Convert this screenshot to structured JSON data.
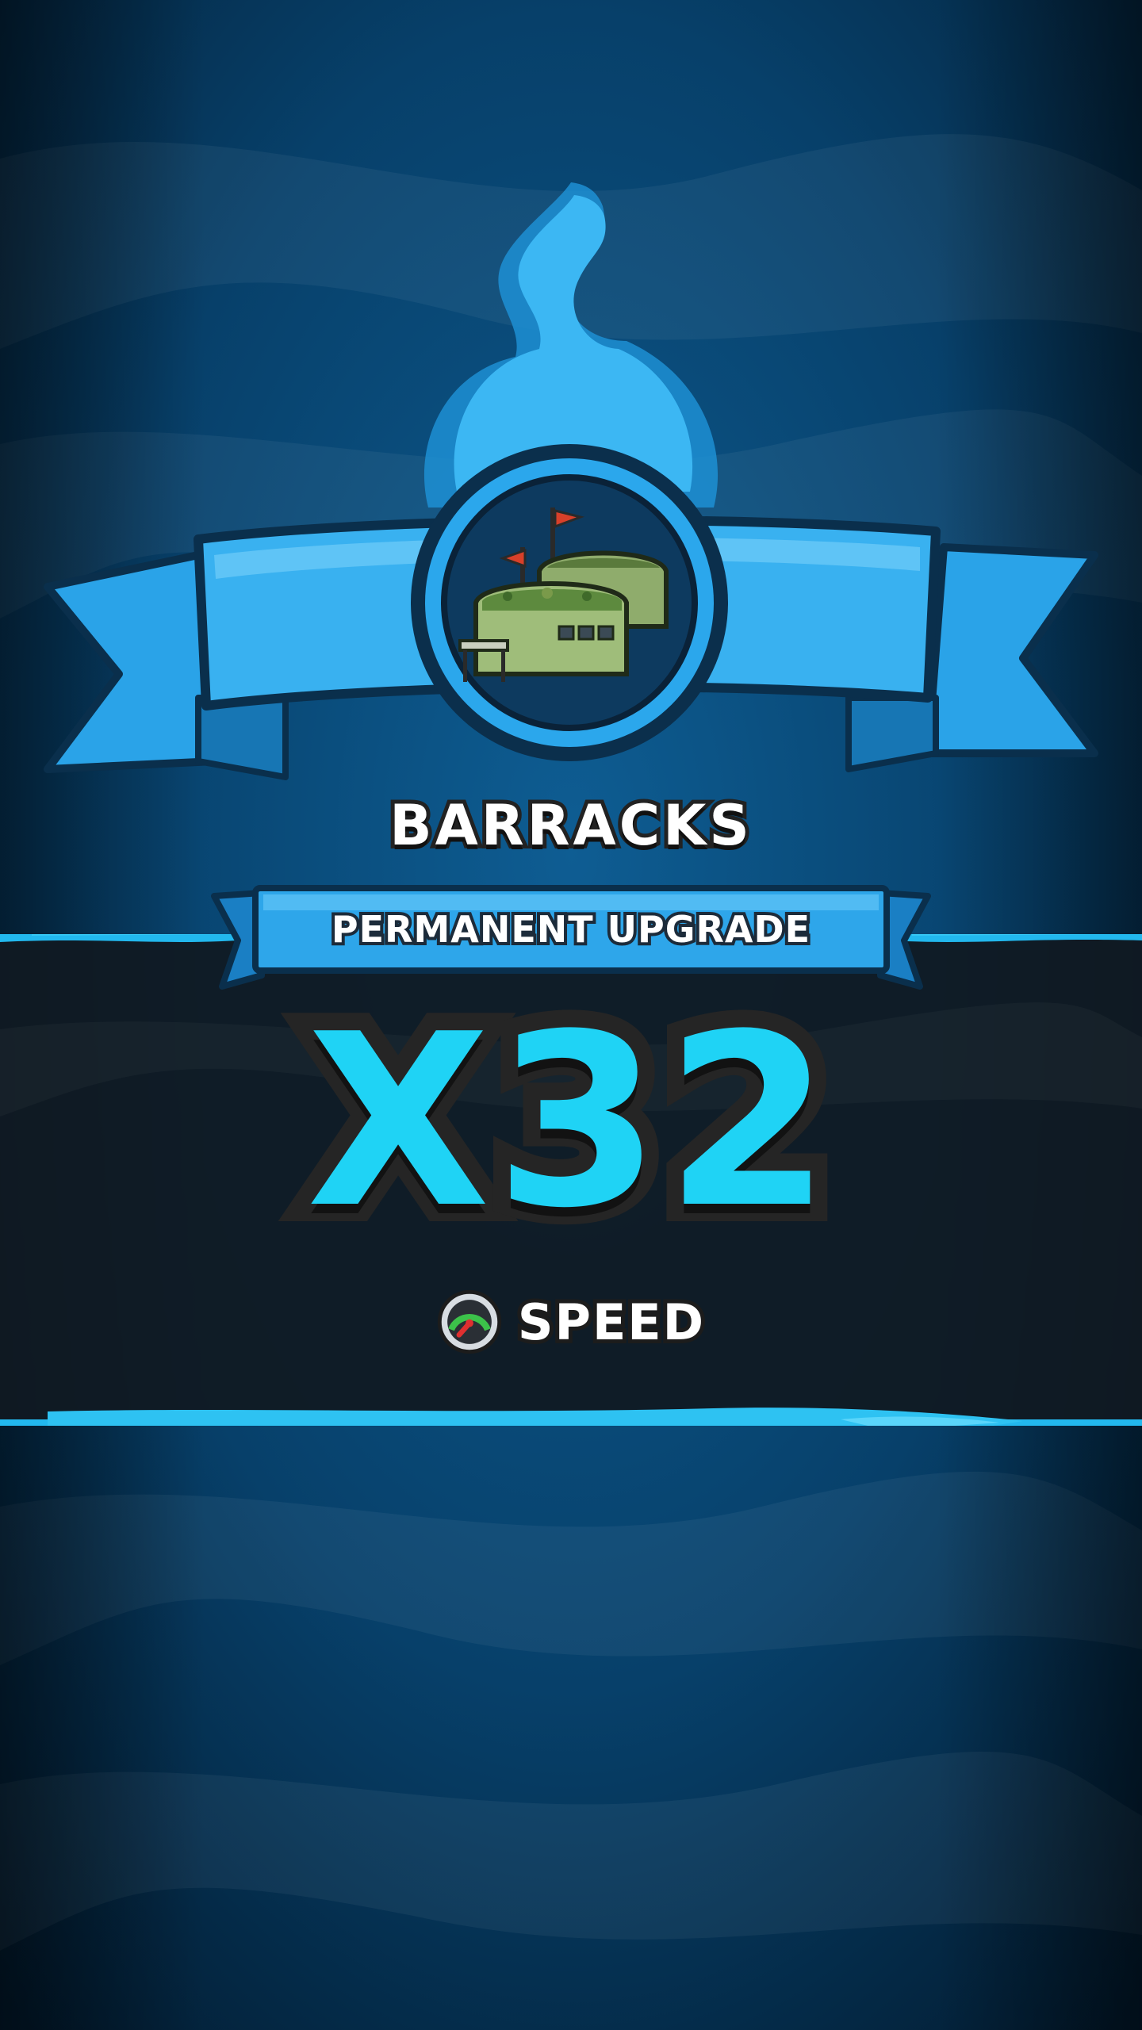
{
  "reward": {
    "building_name": "BARRACKS",
    "upgrade_type": "PERMANENT UPGRADE",
    "multiplier": "X32",
    "stat_name": "SPEED",
    "stat_icon": "speedometer-icon",
    "building_icon": "barracks-icon"
  },
  "colors": {
    "background": "#0a4c7a",
    "ribbon": "#2aa3e8",
    "flame": "#39b4f2",
    "multiplier": "#1fd3f5",
    "dark_band": "#101a22"
  }
}
